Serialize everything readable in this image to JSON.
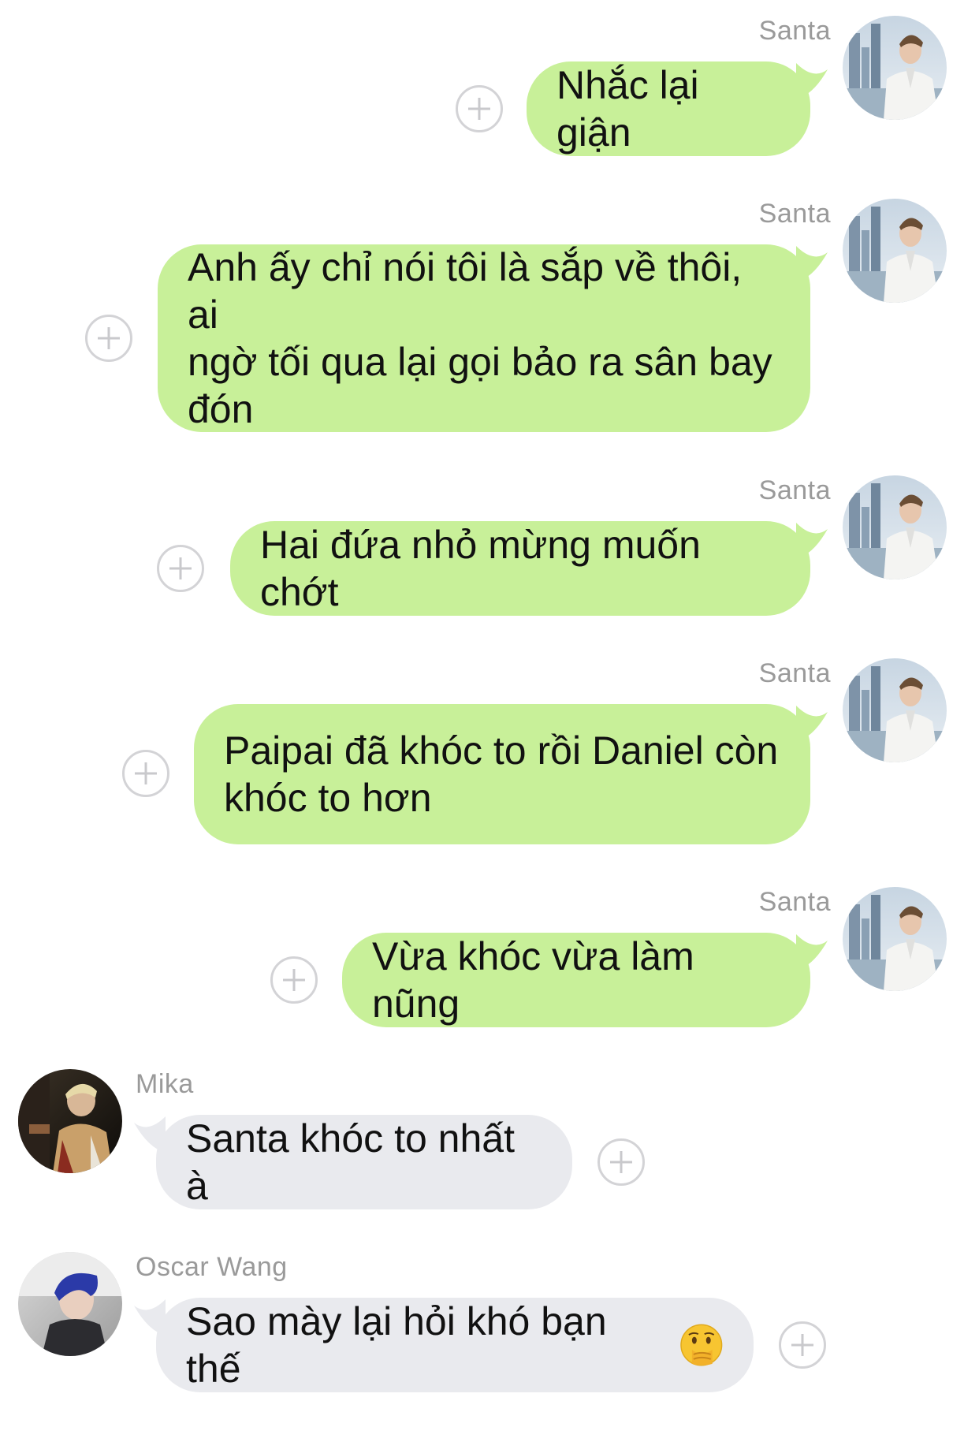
{
  "chat": {
    "messages": [
      {
        "sender": "Santa",
        "text": "Nhắc lại giận",
        "direction": "outgoing"
      },
      {
        "sender": "Santa",
        "text": "Anh ấy chỉ nói tôi là sắp về thôi, ai\nngờ tối qua lại gọi bảo ra sân bay\nđón",
        "direction": "outgoing"
      },
      {
        "sender": "Santa",
        "text": "Hai đứa nhỏ mừng muốn chớt",
        "direction": "outgoing"
      },
      {
        "sender": "Santa",
        "text": "Paipai đã khóc to rồi Daniel còn\nkhóc to hơn",
        "direction": "outgoing"
      },
      {
        "sender": "Santa",
        "text": "Vừa khóc vừa làm nũng",
        "direction": "outgoing"
      },
      {
        "sender": "Mika",
        "text": "Santa khóc to nhất à",
        "direction": "incoming"
      },
      {
        "sender": "Oscar Wang",
        "text": "Sao mày lại hỏi khó bạn thế",
        "direction": "incoming",
        "emoji": "shushing-face-emoji"
      }
    ]
  },
  "colors": {
    "outgoing_bubble": "#c8f099",
    "incoming_bubble": "#e9eaee",
    "sender_name": "#9a9a9a",
    "add_reaction_icon": "#d3d3d6"
  },
  "icons": {
    "add_reaction": "plus-circle-icon"
  }
}
